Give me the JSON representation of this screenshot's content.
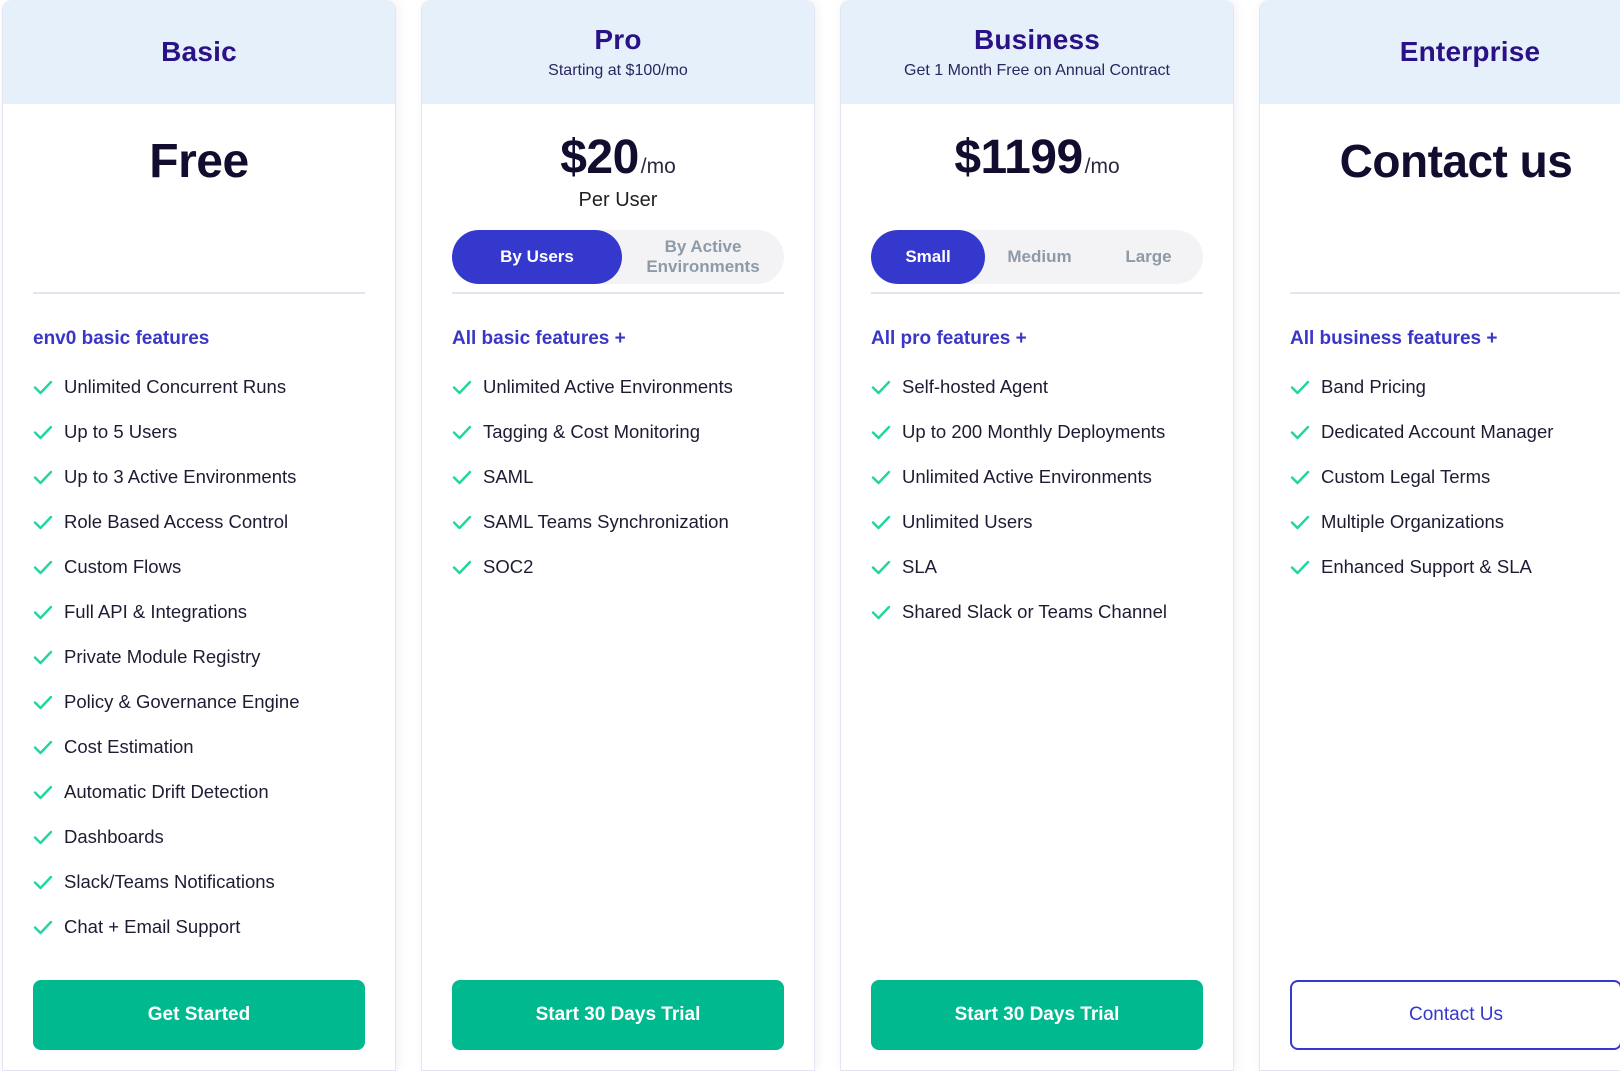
{
  "colors": {
    "accent": "#3538cd",
    "header_bg": "#e6f0fa",
    "plan_name": "#2a1185",
    "check": "#1fd6a1",
    "cta_green": "#00b98e"
  },
  "plans": [
    {
      "name": "Basic",
      "subtitle": "",
      "price": "Free",
      "price_unit": "",
      "price_note": "",
      "features_title": "env0 basic features",
      "features": [
        "Unlimited Concurrent Runs",
        "Up to 5 Users",
        "Up to 3 Active Environments",
        "Role Based Access Control",
        "Custom Flows",
        "Full API & Integrations",
        "Private Module Registry",
        "Policy & Governance Engine",
        "Cost Estimation",
        "Automatic Drift Detection",
        "Dashboards",
        "Slack/Teams Notifications",
        "Chat + Email Support"
      ],
      "cta": "Get Started"
    },
    {
      "name": "Pro",
      "subtitle": "Starting at $100/mo",
      "price": "$20",
      "price_unit": "/mo",
      "price_note": "Per User",
      "toggle": {
        "options": [
          "By Users",
          "By Active Environments"
        ],
        "selected": "By Users"
      },
      "features_title": "All basic features +",
      "features": [
        "Unlimited Active Environments",
        "Tagging & Cost Monitoring",
        "SAML",
        "SAML Teams Synchronization",
        "SOC2"
      ],
      "cta": "Start 30 Days Trial"
    },
    {
      "name": "Business",
      "subtitle": "Get 1 Month Free on Annual Contract",
      "price": "$1199",
      "price_unit": "/mo",
      "price_note": "",
      "toggle": {
        "options": [
          "Small",
          "Medium",
          "Large"
        ],
        "selected": "Small"
      },
      "features_title": "All pro features +",
      "features": [
        "Self-hosted Agent",
        "Up to 200 Monthly Deployments",
        "Unlimited Active Environments",
        "Unlimited Users",
        "SLA",
        "Shared Slack or Teams Channel"
      ],
      "cta": "Start 30 Days Trial"
    },
    {
      "name": "Enterprise",
      "subtitle": "",
      "price": "Contact us",
      "price_unit": "",
      "price_note": "",
      "features_title": "All business features +",
      "features": [
        "Band Pricing",
        "Dedicated Account Manager",
        "Custom Legal Terms",
        "Multiple Organizations",
        "Enhanced Support & SLA"
      ],
      "cta": "Contact Us"
    }
  ]
}
